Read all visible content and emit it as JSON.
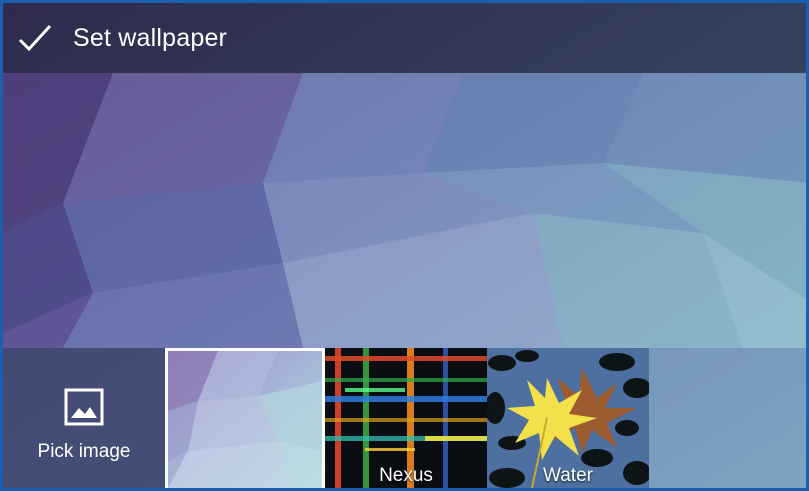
{
  "action_bar": {
    "icon": "checkmark-icon",
    "title": "Set wallpaper"
  },
  "wallpaper_tray": {
    "pick_image": {
      "icon": "image-icon",
      "label": "Pick image"
    },
    "thumbnails": [
      {
        "label": "",
        "selected": true
      },
      {
        "label": "Nexus",
        "selected": false
      },
      {
        "label": "Water",
        "selected": false
      }
    ]
  },
  "colors": {
    "action_bar_bg": "#141828",
    "selected_border": "#ffffff",
    "frame_border": "#1b5fb0"
  }
}
